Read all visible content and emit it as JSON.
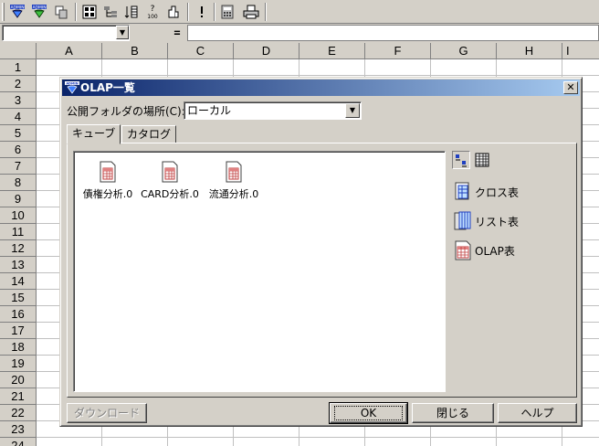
{
  "toolbar": {
    "buttons": [
      {
        "name": "admin-diamond-icon-1"
      },
      {
        "name": "admin-diamond-icon-2"
      },
      {
        "name": "copy-pages-icon"
      },
      {
        "name": "grid-layout-icon"
      },
      {
        "name": "hierarchy-icon"
      },
      {
        "name": "column-sort-icon"
      },
      {
        "name": "question-100-icon"
      },
      {
        "name": "stack-icon"
      },
      {
        "name": "exclamation-icon"
      },
      {
        "name": "calculator-icon"
      },
      {
        "name": "printer-icon"
      }
    ],
    "accent": "#2040c0"
  },
  "formula_bar": {
    "name_box_value": "",
    "equals": "=",
    "formula_value": ""
  },
  "sheet": {
    "columns": [
      "A",
      "B",
      "C",
      "D",
      "E",
      "F",
      "G",
      "H",
      "I"
    ],
    "rows": [
      "1",
      "2",
      "3",
      "4",
      "5",
      "6",
      "7",
      "8",
      "9",
      "10",
      "11",
      "12",
      "13",
      "14",
      "15",
      "16",
      "17",
      "18",
      "19",
      "20",
      "21",
      "22",
      "23",
      "24"
    ]
  },
  "dialog": {
    "title": "OLAP一覧",
    "close_label": "✕",
    "folder_label": "公開フォルダの場所(C):",
    "folder_value": "ローカル",
    "tabs": [
      {
        "label": "キューブ"
      },
      {
        "label": "カタログ"
      }
    ],
    "cubes": [
      {
        "label": "債権分析.0"
      },
      {
        "label": "CARD分析.0"
      },
      {
        "label": "流通分析.0"
      }
    ],
    "report_types": [
      {
        "label": "クロス表"
      },
      {
        "label": "リスト表"
      },
      {
        "label": "OLAP表"
      }
    ],
    "buttons": {
      "download": "ダウンロード",
      "ok": "OK",
      "close": "閉じる",
      "help": "ヘルプ"
    }
  },
  "colors": {
    "title_gradient_start": "#0a246a",
    "title_gradient_end": "#a6caf0",
    "face": "#d4d0c8"
  }
}
